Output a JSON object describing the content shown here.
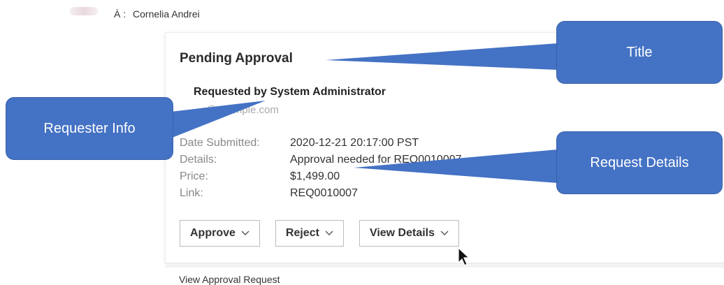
{
  "email": {
    "to_label": "À :",
    "to_name": "Cornelia Andrei",
    "card": {
      "title": "Pending Approval",
      "requester_name": "Requested by System Administrator",
      "requester_email": "...r@example.com",
      "details": [
        {
          "label": "Date Submitted:",
          "value": "2020-12-21 20:17:00 PST"
        },
        {
          "label": "Details:",
          "value": "Approval needed for REQ0010007"
        },
        {
          "label": "Price:",
          "value": "$1,499.00"
        },
        {
          "label": "Link:",
          "value": "REQ0010007"
        }
      ],
      "buttons": {
        "approve": "Approve",
        "reject": "Reject",
        "view_details": "View Details"
      }
    },
    "footer_link": "View Approval Request"
  },
  "callouts": {
    "title": "Title",
    "requester_info": "Requester Info",
    "request_details": "Request Details"
  },
  "colors": {
    "callout_fill": "#4472c4",
    "callout_text": "#ffffff"
  }
}
